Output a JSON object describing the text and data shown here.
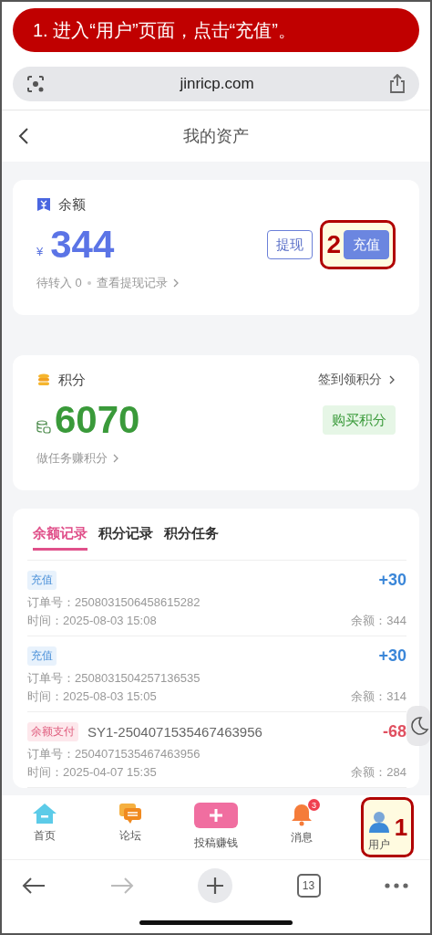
{
  "banner": {
    "text": "1. 进入“用户”页面，点击“充值”。"
  },
  "browser": {
    "url": "jinricp.com",
    "tab_count": "13"
  },
  "header": {
    "title": "我的资产"
  },
  "balance": {
    "label": "余额",
    "currency": "¥",
    "amount": "344",
    "pending": "待转入 0",
    "link": "查看提现记录",
    "buttons": [
      {
        "kind": "outline",
        "label": "提现"
      },
      {
        "kind": "primary",
        "label": "充值",
        "callout": "2"
      }
    ]
  },
  "points": {
    "label": "积分",
    "sign_in": "签到领积分",
    "amount": "6070",
    "buy": "购买积分",
    "tasks": "做任务赚积分"
  },
  "records": {
    "tabs": [
      {
        "label": "余额记录",
        "selected": true
      },
      {
        "label": "积分记录",
        "selected": false
      },
      {
        "label": "积分任务",
        "selected": false
      }
    ],
    "rows": [
      {
        "kind": "income",
        "tag": "充值",
        "amount": "+30",
        "order": "订单号：2508031506458615282",
        "time": "时间：2025-08-03 15:08",
        "balance": "余额：344"
      },
      {
        "kind": "income",
        "tag": "充值",
        "amount": "+30",
        "order": "订单号：2508031504257136535",
        "time": "时间：2025-08-03 15:05",
        "balance": "余额：314"
      },
      {
        "kind": "payment",
        "tag": "余额支付",
        "reference": "SY1-2504071535467463956",
        "amount": "-68",
        "order": "订单号：2504071535467463956",
        "time": "时间：2025-04-07 15:35",
        "balance": "余额：284"
      }
    ]
  },
  "nav": [
    {
      "kind": "home",
      "label": "首页"
    },
    {
      "kind": "forum",
      "label": "论坛"
    },
    {
      "kind": "post",
      "label": "投稿赚钱"
    },
    {
      "kind": "messages",
      "label": "消息",
      "badge": "3"
    },
    {
      "kind": "user",
      "label": "用户",
      "callout": "1"
    }
  ]
}
